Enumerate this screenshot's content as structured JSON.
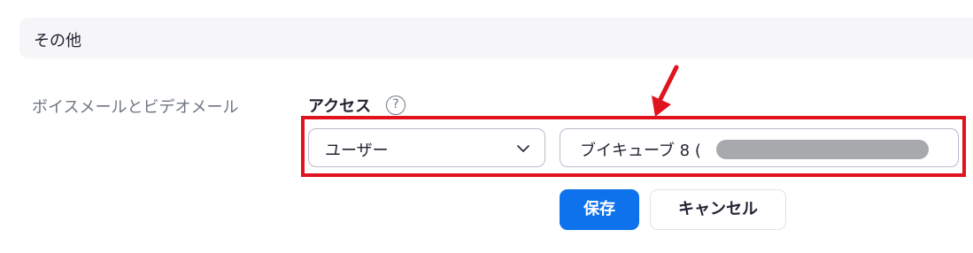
{
  "section": {
    "title": "その他"
  },
  "voicemail": {
    "label": "ボイスメールとビデオメール",
    "access_label": "アクセス",
    "help_icon": "?",
    "select_value": "ユーザー",
    "user_value": "ブイキューブ 8 ("
  },
  "buttons": {
    "save": "保存",
    "cancel": "キャンセル"
  },
  "colors": {
    "accent": "#0e72ed",
    "annotation": "#e0141e"
  }
}
